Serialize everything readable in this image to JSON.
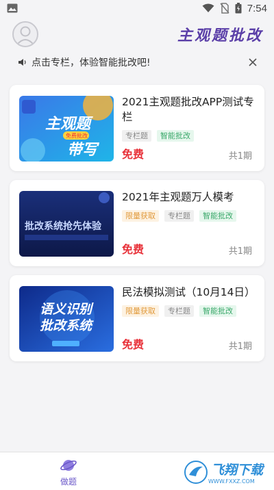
{
  "status_bar": {
    "time": "7:54"
  },
  "header": {
    "title": "主观题批改"
  },
  "notice": {
    "text": "点击专栏，体验智能批改吧!"
  },
  "cards": [
    {
      "title": "2021主观题批改APP测试专栏",
      "thumb_text_1": "主观题",
      "thumb_text_2": "带写",
      "thumb_badge": "免费批改",
      "tags": [
        "专栏题",
        "智能批改"
      ],
      "tag_colors": [
        "gray",
        "green"
      ],
      "price": "免费",
      "issues": "共1期"
    },
    {
      "title": "2021年主观题万人模考",
      "thumb_text_1": "批改系统抢先体验",
      "tags": [
        "限量获取",
        "专栏题",
        "智能批改"
      ],
      "tag_colors": [
        "orange",
        "gray",
        "green"
      ],
      "price": "免费",
      "issues": "共1期"
    },
    {
      "title": "民法模拟测试（10月14日）",
      "thumb_text_1": "语义识别",
      "thumb_text_2": "批改系统",
      "tags": [
        "限量获取",
        "专栏题",
        "智能批改"
      ],
      "tag_colors": [
        "orange",
        "gray",
        "green"
      ],
      "price": "免费",
      "issues": "共1期"
    }
  ],
  "bottom_nav": {
    "items": [
      {
        "label": "做题",
        "icon": "planet-icon"
      }
    ]
  },
  "watermark": {
    "text": "飞翔下载",
    "sub": "WWW.FXXZ.COM"
  },
  "colors": {
    "accent": "#5b3fa8",
    "price": "#e8323a",
    "nav_active": "#6a57c9"
  }
}
